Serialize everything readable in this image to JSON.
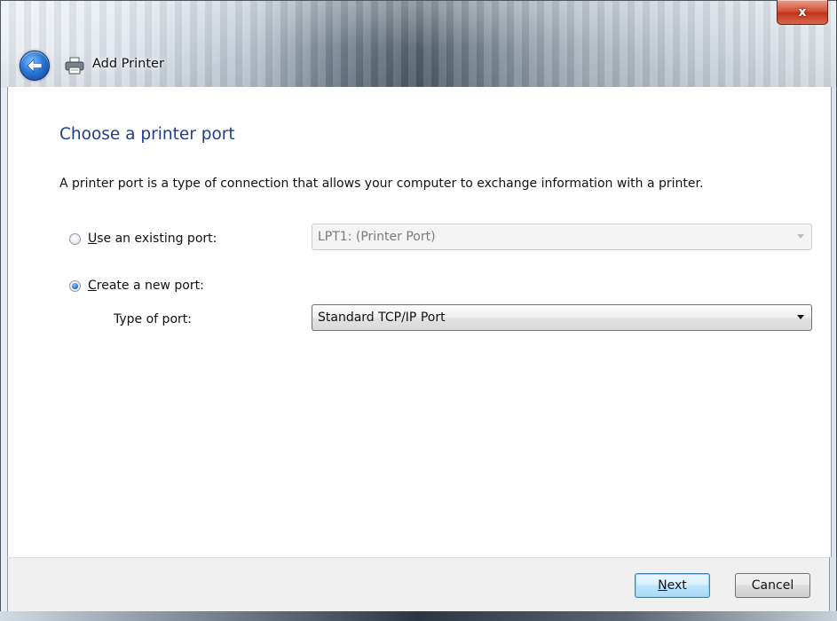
{
  "window": {
    "title": "Add Printer",
    "close_label": "x"
  },
  "page": {
    "heading": "Choose a printer port",
    "description": "A printer port is a type of connection that allows your computer to exchange information with a printer."
  },
  "options": {
    "existing": {
      "label_prefix": "",
      "label_access": "U",
      "label_rest": "se an existing port:",
      "selected": false,
      "port_value": "LPT1: (Printer Port)"
    },
    "new": {
      "label_access": "C",
      "label_rest": "reate a new port:",
      "selected": true,
      "type_label": "Type of port:",
      "type_value": "Standard TCP/IP Port"
    }
  },
  "buttons": {
    "next_access": "N",
    "next_rest": "ext",
    "cancel": "Cancel"
  },
  "colors": {
    "heading": "#1e3f8a",
    "next_border": "#3c7fb1",
    "close": "#c2341c"
  },
  "icons": {
    "back": "back-arrow-icon",
    "printer": "printer-icon",
    "close": "close-icon"
  }
}
